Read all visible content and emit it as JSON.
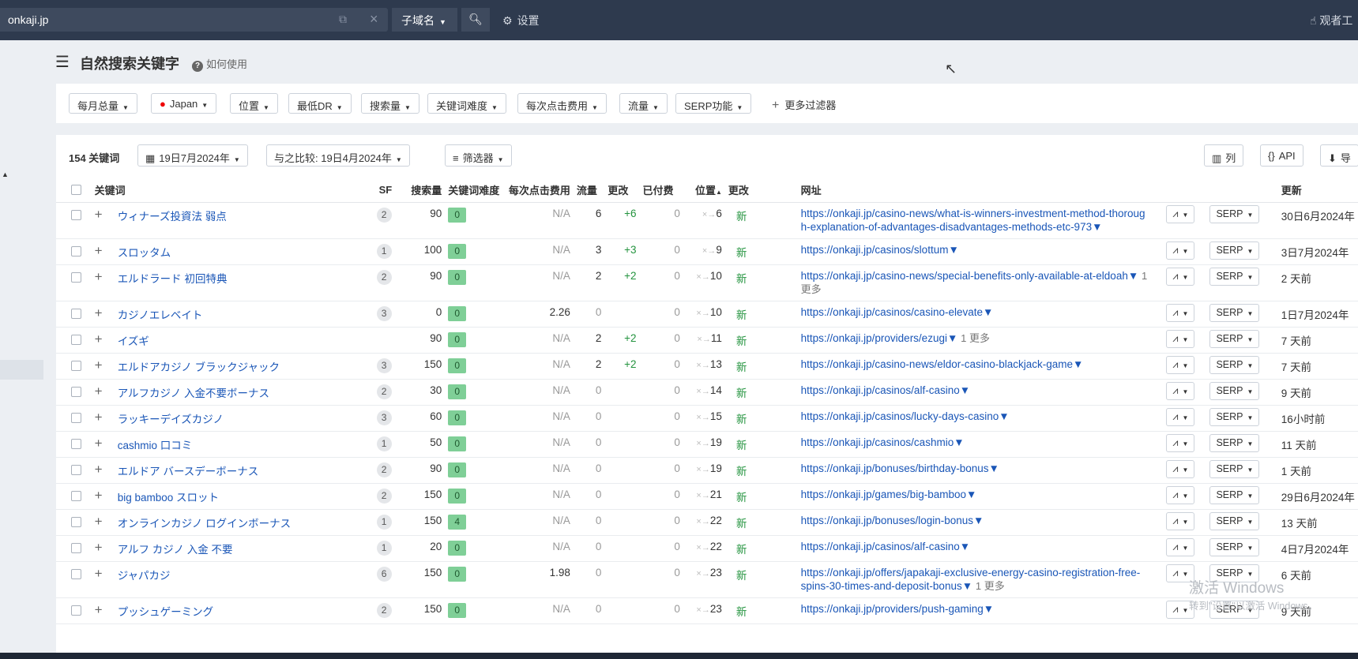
{
  "topbar": {
    "search_value": "onkaji.jp",
    "mode": "子域名",
    "settings": "设置",
    "viewer": "观者工"
  },
  "page": {
    "title": "自然搜索关键字",
    "help": "如何使用"
  },
  "filters": [
    "每月总量",
    "Japan",
    "位置",
    "最低DR",
    "搜索量",
    "关键词难度",
    "每次点击费用",
    "流量",
    "SERP功能"
  ],
  "more_filters": "更多过滤器",
  "toolbar": {
    "count": "154 关键词",
    "date": "19日7月2024年",
    "compare": "与之比较:  19日4月2024年",
    "filter": "筛选器",
    "columns": "列",
    "api": "API",
    "export": "导"
  },
  "columns": [
    "关键词",
    "SF",
    "搜索量",
    "关键词难度",
    "每次点击费用",
    "流量",
    "更改",
    "已付费",
    "位置",
    "更改",
    "网址",
    "",
    "",
    "更新"
  ],
  "rows": [
    {
      "kw": "ウィナーズ投資法 弱点",
      "sf": "2",
      "vol": "90",
      "kd": "0",
      "cpc": "N/A",
      "traffic": "6",
      "change": "+6",
      "paid": "0",
      "pos": "6",
      "status": "新",
      "url": "https://onkaji.jp/casino-news/what-is-winners-investment-method-thoroug",
      "url2": "h-explanation-of-advantages-disadvantages-methods-etc-973",
      "more": "",
      "updated": "30日6月2024年"
    },
    {
      "kw": "スロッタム",
      "sf": "1",
      "vol": "100",
      "kd": "0",
      "cpc": "N/A",
      "traffic": "3",
      "change": "+3",
      "paid": "0",
      "pos": "9",
      "status": "新",
      "url": "https://onkaji.jp/casinos/slottum",
      "url2": "",
      "more": "",
      "updated": "3日7月2024年"
    },
    {
      "kw": "エルドラード 初回特典",
      "sf": "2",
      "vol": "90",
      "kd": "0",
      "cpc": "N/A",
      "traffic": "2",
      "change": "+2",
      "paid": "0",
      "pos": "10",
      "status": "新",
      "url": "https://onkaji.jp/casino-news/special-benefits-only-available-at-eldoah",
      "url2": "",
      "more": "1 更多",
      "updated": "2 天前"
    },
    {
      "kw": "カジノエレベイト",
      "sf": "3",
      "vol": "0",
      "kd": "0",
      "cpc": "2.26",
      "traffic": "0",
      "change": "",
      "paid": "0",
      "pos": "10",
      "status": "新",
      "url": "https://onkaji.jp/casinos/casino-elevate",
      "url2": "",
      "more": "",
      "updated": "1日7月2024年"
    },
    {
      "kw": "イズギ",
      "sf": "",
      "vol": "90",
      "kd": "0",
      "cpc": "N/A",
      "traffic": "2",
      "change": "+2",
      "paid": "0",
      "pos": "11",
      "status": "新",
      "url": "https://onkaji.jp/providers/ezugi",
      "url2": "",
      "more": "1 更多",
      "updated": "7 天前"
    },
    {
      "kw": "エルドアカジノ ブラックジャック",
      "sf": "3",
      "vol": "150",
      "kd": "0",
      "cpc": "N/A",
      "traffic": "2",
      "change": "+2",
      "paid": "0",
      "pos": "13",
      "status": "新",
      "url": "https://onkaji.jp/casino-news/eldor-casino-blackjack-game",
      "url2": "",
      "more": "",
      "updated": "7 天前"
    },
    {
      "kw": "アルフカジノ 入金不要ボーナス",
      "sf": "2",
      "vol": "30",
      "kd": "0",
      "cpc": "N/A",
      "traffic": "0",
      "change": "",
      "paid": "0",
      "pos": "14",
      "status": "新",
      "url": "https://onkaji.jp/casinos/alf-casino",
      "url2": "",
      "more": "",
      "updated": "9 天前"
    },
    {
      "kw": "ラッキーデイズカジノ",
      "sf": "3",
      "vol": "60",
      "kd": "0",
      "cpc": "N/A",
      "traffic": "0",
      "change": "",
      "paid": "0",
      "pos": "15",
      "status": "新",
      "url": "https://onkaji.jp/casinos/lucky-days-casino",
      "url2": "",
      "more": "",
      "updated": "16小时前"
    },
    {
      "kw": "cashmio 口コミ",
      "sf": "1",
      "vol": "50",
      "kd": "0",
      "cpc": "N/A",
      "traffic": "0",
      "change": "",
      "paid": "0",
      "pos": "19",
      "status": "新",
      "url": "https://onkaji.jp/casinos/cashmio",
      "url2": "",
      "more": "",
      "updated": "11 天前"
    },
    {
      "kw": "エルドア バースデーボーナス",
      "sf": "2",
      "vol": "90",
      "kd": "0",
      "cpc": "N/A",
      "traffic": "0",
      "change": "",
      "paid": "0",
      "pos": "19",
      "status": "新",
      "url": "https://onkaji.jp/bonuses/birthday-bonus",
      "url2": "",
      "more": "",
      "updated": "1 天前"
    },
    {
      "kw": "big bamboo スロット",
      "sf": "2",
      "vol": "150",
      "kd": "0",
      "cpc": "N/A",
      "traffic": "0",
      "change": "",
      "paid": "0",
      "pos": "21",
      "status": "新",
      "url": "https://onkaji.jp/games/big-bamboo",
      "url2": "",
      "more": "",
      "updated": "29日6月2024年"
    },
    {
      "kw": "オンラインカジノ ログインボーナス",
      "sf": "1",
      "vol": "150",
      "kd": "4",
      "cpc": "N/A",
      "traffic": "0",
      "change": "",
      "paid": "0",
      "pos": "22",
      "status": "新",
      "url": "https://onkaji.jp/bonuses/login-bonus",
      "url2": "",
      "more": "",
      "updated": "13 天前"
    },
    {
      "kw": "アルフ カジノ 入金 不要",
      "sf": "1",
      "vol": "20",
      "kd": "0",
      "cpc": "N/A",
      "traffic": "0",
      "change": "",
      "paid": "0",
      "pos": "22",
      "status": "新",
      "url": "https://onkaji.jp/casinos/alf-casino",
      "url2": "",
      "more": "",
      "updated": "4日7月2024年"
    },
    {
      "kw": "ジャパカジ",
      "sf": "6",
      "vol": "150",
      "kd": "0",
      "cpc": "1.98",
      "traffic": "0",
      "change": "",
      "paid": "0",
      "pos": "23",
      "status": "新",
      "url": "https://onkaji.jp/offers/japakaji-exclusive-energy-casino-registration-free-",
      "url2": "spins-30-times-and-deposit-bonus",
      "more": "1 更多",
      "updated": "6 天前"
    },
    {
      "kw": "プッシュゲーミング",
      "sf": "2",
      "vol": "150",
      "kd": "0",
      "cpc": "N/A",
      "traffic": "0",
      "change": "",
      "paid": "0",
      "pos": "23",
      "status": "新",
      "url": "https://onkaji.jp/providers/push-gaming",
      "url2": "",
      "more": "",
      "updated": "9 天前"
    }
  ],
  "row_buttons": {
    "chart": "",
    "serp": "SERP"
  },
  "watermark": {
    "line1": "激活 Windows",
    "line2": "转到\"设置\"以激活 Windows。"
  }
}
